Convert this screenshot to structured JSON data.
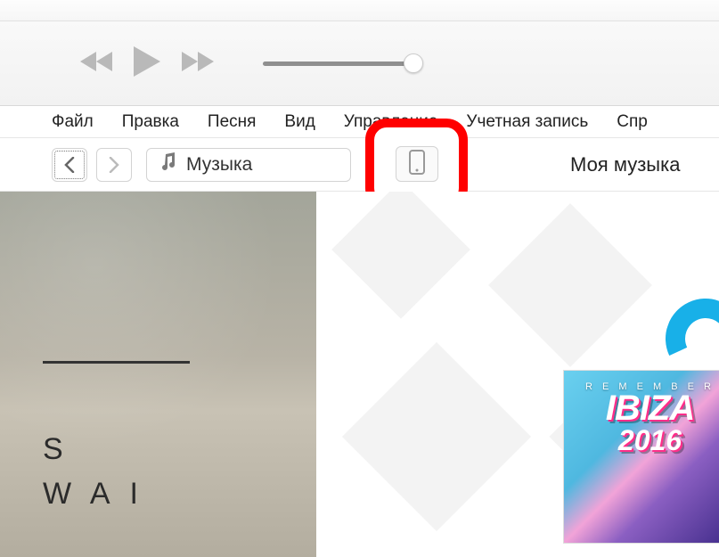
{
  "menu": {
    "file": "Файл",
    "edit": "Правка",
    "song": "Песня",
    "view": "Вид",
    "controls": "Управление",
    "account": "Учетная запись",
    "help": "Спр"
  },
  "toolbar": {
    "media_label": "Музыка",
    "section_label": "Моя музыка"
  },
  "artwork": {
    "line1": "S",
    "line2": "WAI"
  },
  "album": {
    "top_text": "R E M E M B E R",
    "title": "IBIZA",
    "year": "2016"
  }
}
